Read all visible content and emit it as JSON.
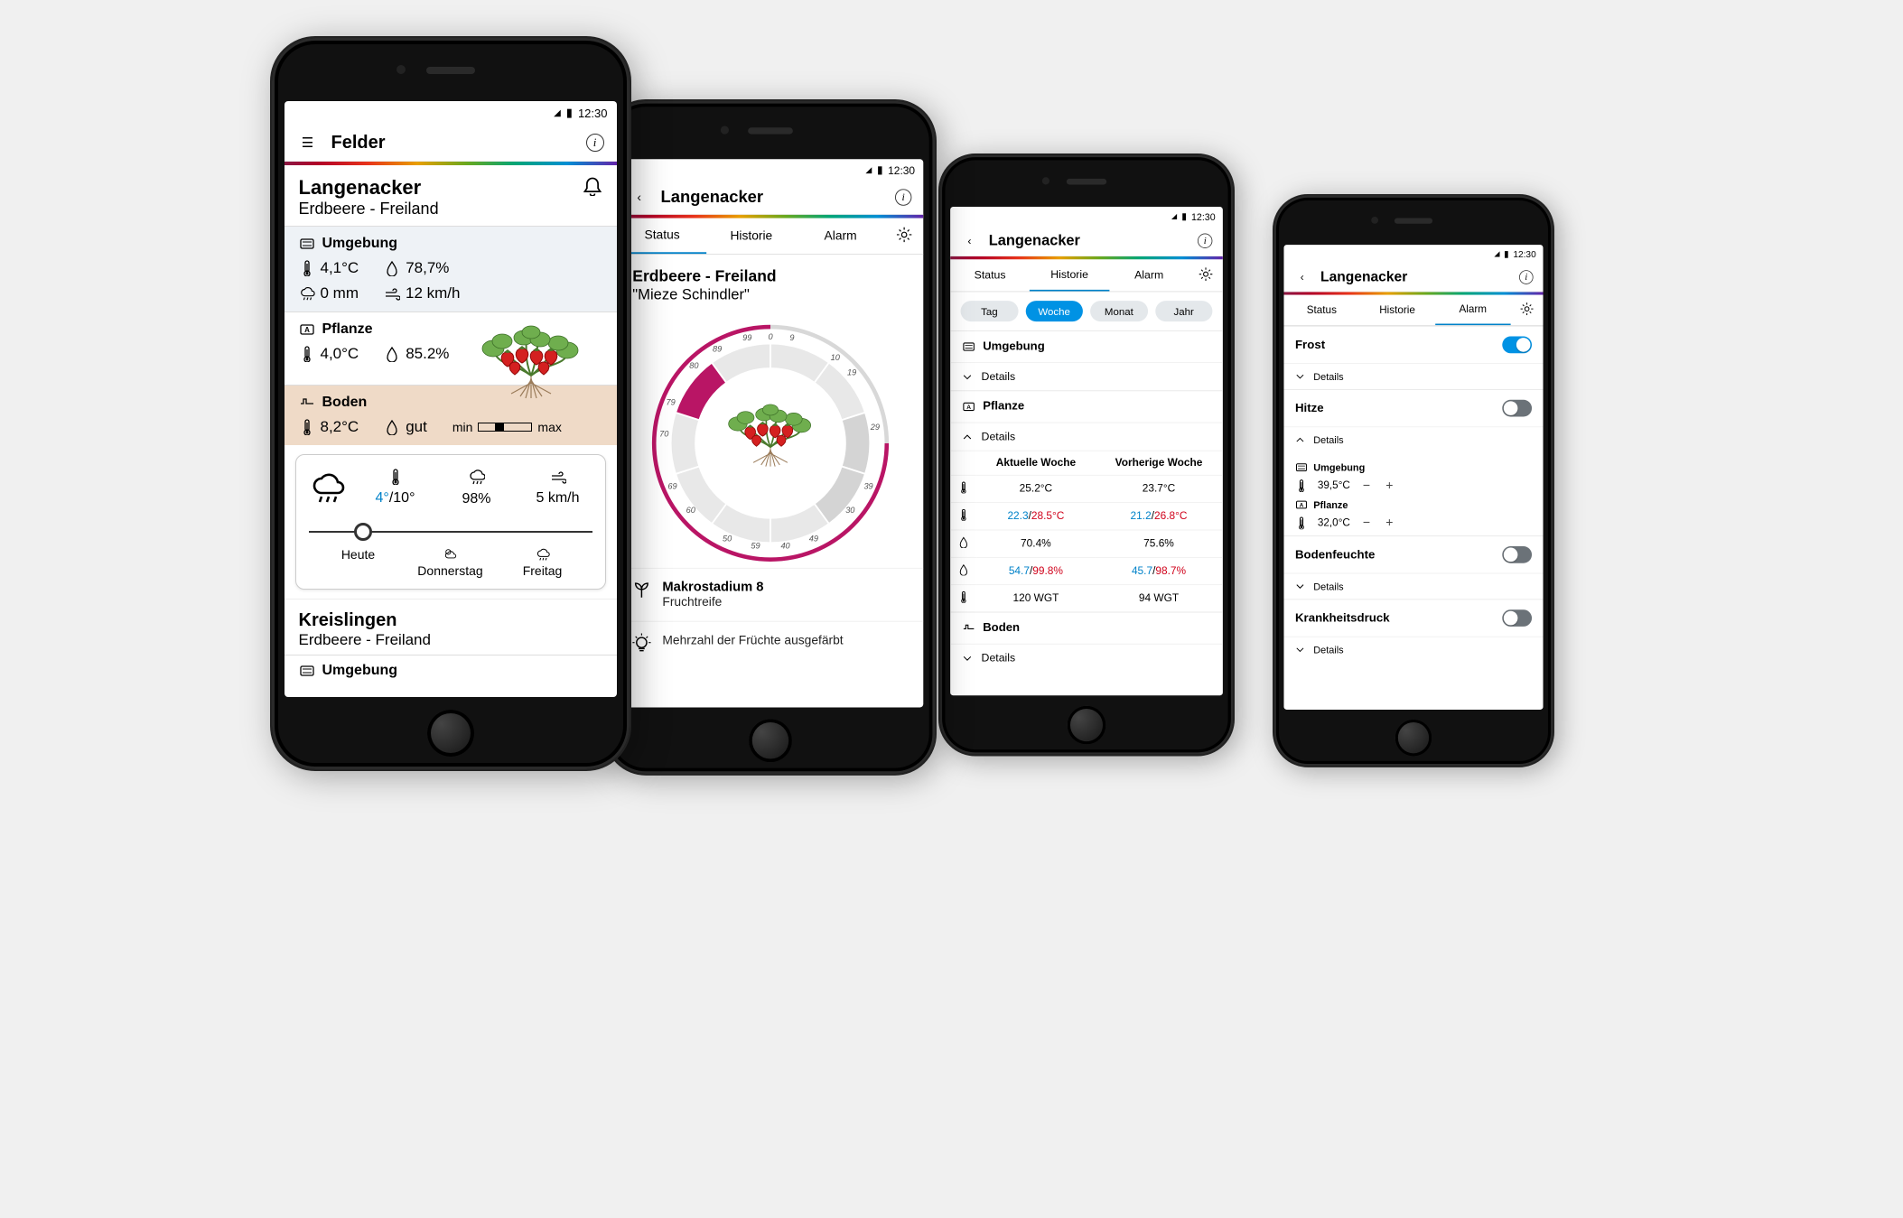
{
  "status_time": "12:30",
  "p1": {
    "title": "Felder",
    "field": {
      "name": "Langenacker",
      "crop": "Erdbeere - Freiland"
    },
    "env": {
      "label": "Umgebung",
      "temp": "4,1°C",
      "humidity": "78,7%",
      "precip": "0 mm",
      "wind": "12 km/h"
    },
    "plant": {
      "label": "Pflanze",
      "temp": "4,0°C",
      "humidity": "85.2%"
    },
    "soil": {
      "label": "Boden",
      "temp": "8,2°C",
      "moist": "gut",
      "min": "min",
      "max": "max"
    },
    "forecast": {
      "temp_low": "4°",
      "temp_high": "10°",
      "humidity": "98%",
      "wind": "5 km/h",
      "days": [
        "Heute",
        "Donnerstag",
        "Freitag"
      ]
    },
    "field2": {
      "name": "Kreislingen",
      "crop": "Erdbeere - Freiland",
      "env_label": "Umgebung"
    }
  },
  "p2": {
    "title": "Langenacker",
    "tabs": [
      "Status",
      "Historie",
      "Alarm"
    ],
    "active_tab": 0,
    "crop": "Erdbeere - Freiland",
    "variety": "\"Mieze Schindler\"",
    "gauge_ticks": [
      "0",
      "9",
      "10",
      "19",
      "29",
      "39",
      "49",
      "59",
      "50",
      "60",
      "69",
      "79",
      "70",
      "80",
      "89",
      "99"
    ],
    "macro": {
      "label": "Makrostadium 8",
      "sub": "Fruchtreife"
    },
    "tip": "Mehrzahl der Früchte ausgefärbt"
  },
  "p3": {
    "title": "Langenacker",
    "tabs": [
      "Status",
      "Historie",
      "Alarm"
    ],
    "active_tab": 1,
    "ranges": [
      "Tag",
      "Woche",
      "Monat",
      "Jahr"
    ],
    "active_range": 1,
    "env": {
      "label": "Umgebung",
      "details": "Details"
    },
    "plant": {
      "label": "Pflanze",
      "details": "Details",
      "col_cur": "Aktuelle Woche",
      "col_prev": "Vorherige Woche",
      "rows": [
        {
          "cur": "25.2°C",
          "prev": "23.7°C"
        },
        {
          "cur_lo": "22.3",
          "cur_hi": "28.5°C",
          "prev_lo": "21.2",
          "prev_hi": "26.8°C"
        },
        {
          "cur": "70.4%",
          "prev": "75.6%"
        },
        {
          "cur_lo": "54.7",
          "cur_hi": "99.8%",
          "prev_lo": "45.7",
          "prev_hi": "98.7%"
        },
        {
          "cur": "120 WGT",
          "prev": "94 WGT"
        }
      ]
    },
    "soil": {
      "label": "Boden",
      "details": "Details"
    }
  },
  "p4": {
    "title": "Langenacker",
    "tabs": [
      "Status",
      "Historie",
      "Alarm"
    ],
    "active_tab": 2,
    "alarms": {
      "frost": {
        "label": "Frost",
        "on": true,
        "details": "Details"
      },
      "hitze": {
        "label": "Hitze",
        "on": false,
        "details": "Details",
        "env_label": "Umgebung",
        "env_val": "39,5°C",
        "plant_label": "Pflanze",
        "plant_val": "32,0°C"
      },
      "boden": {
        "label": "Bodenfeuchte",
        "on": false,
        "details": "Details"
      },
      "krank": {
        "label": "Krankheitsdruck",
        "on": false,
        "details": "Details"
      }
    }
  }
}
